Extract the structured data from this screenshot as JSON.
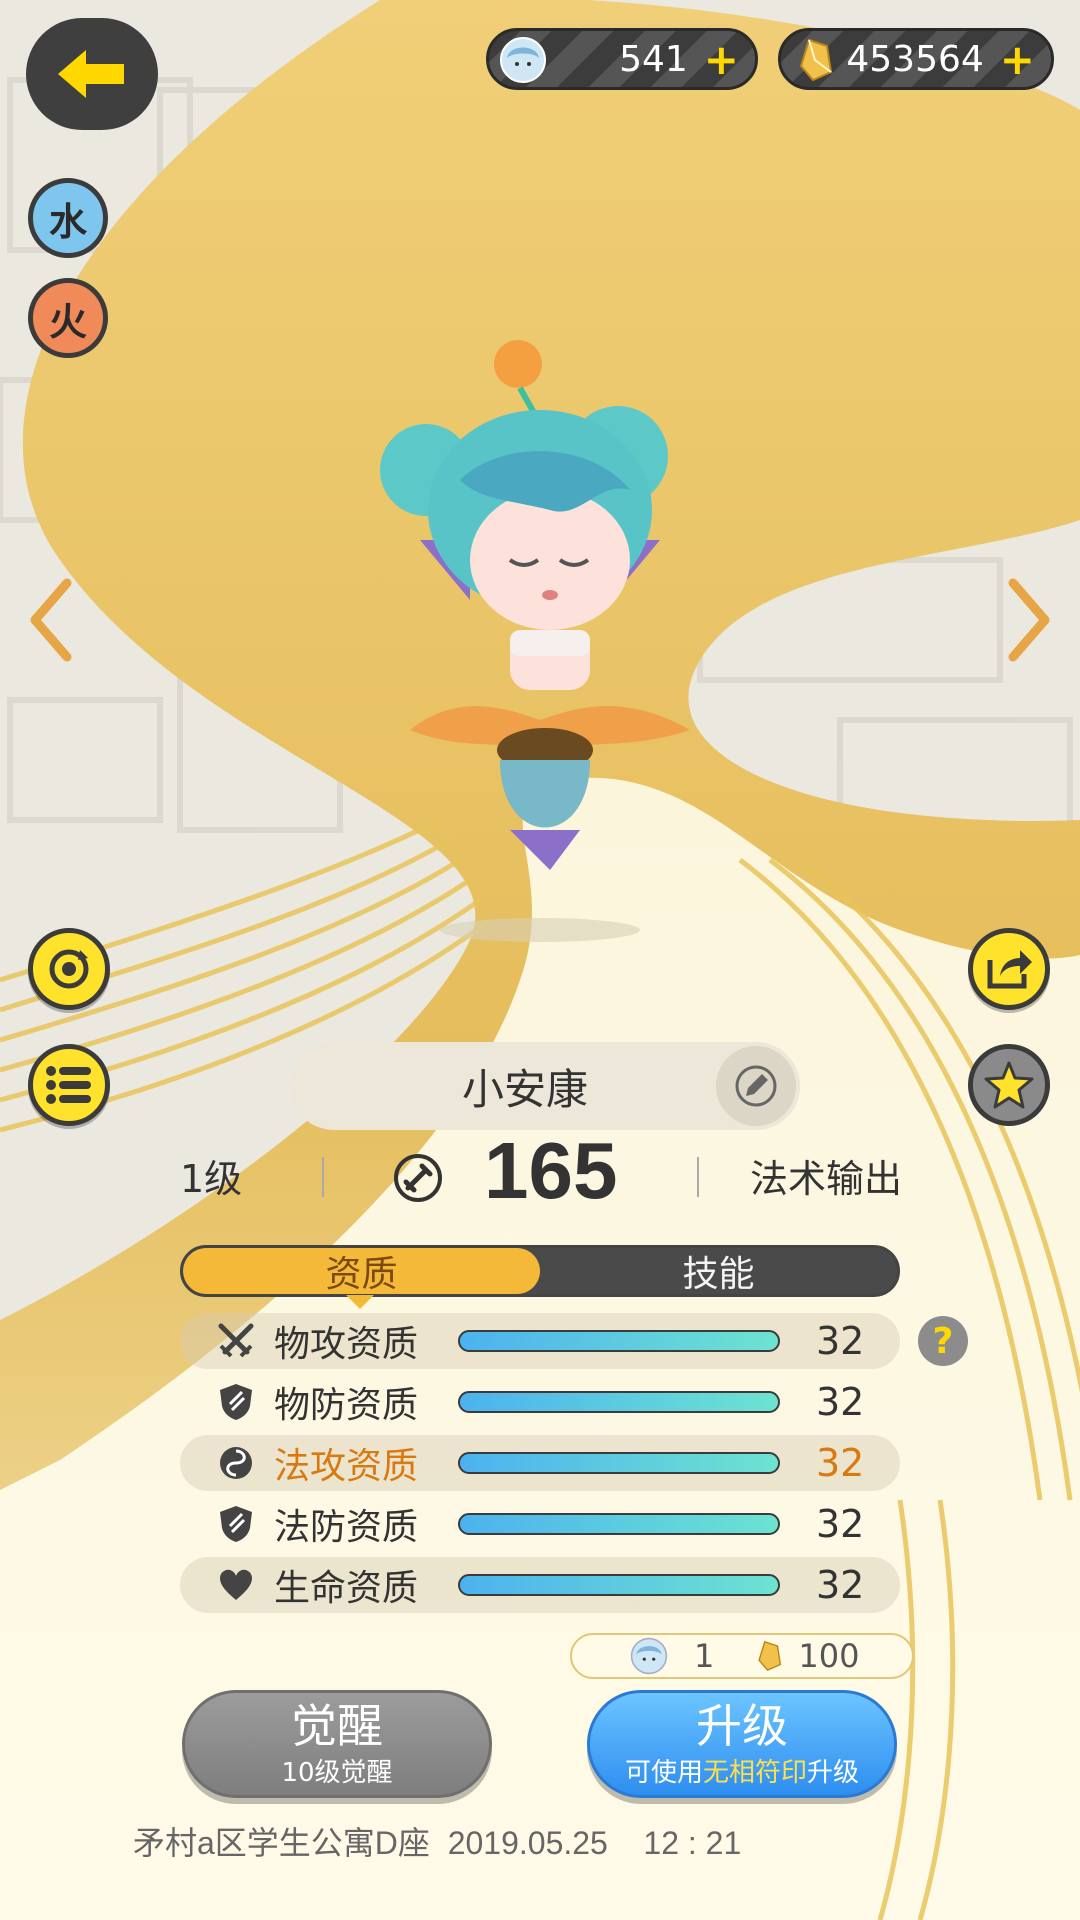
{
  "currencies": [
    {
      "name": "spirit-coin",
      "value": "541",
      "plus": "+"
    },
    {
      "name": "crystal",
      "value": "453564",
      "plus": "+"
    }
  ],
  "elements": [
    "水",
    "火"
  ],
  "pet": {
    "name": "小安康",
    "level": "1级",
    "power": "165",
    "role": "法术输出"
  },
  "tabs": [
    {
      "label": "资质",
      "active": true
    },
    {
      "label": "技能",
      "active": false
    }
  ],
  "stats": [
    {
      "label": "物攻资质",
      "value": "32",
      "icon": "sword-icon",
      "fill": 1.0
    },
    {
      "label": "物防资质",
      "value": "32",
      "icon": "shield-icon",
      "fill": 1.0
    },
    {
      "label": "法攻资质",
      "value": "32",
      "icon": "swirl-icon",
      "fill": 1.0,
      "highlight": true
    },
    {
      "label": "法防资质",
      "value": "32",
      "icon": "shield-icon",
      "fill": 1.0
    },
    {
      "label": "生命资质",
      "value": "32",
      "icon": "heart-icon",
      "fill": 1.0
    }
  ],
  "help": "?",
  "cost": {
    "coin": "1",
    "crystal": "100"
  },
  "buttons": {
    "awaken": {
      "title": "觉醒",
      "sub": "10级觉醒"
    },
    "upgrade": {
      "title": "升级",
      "sub_pre": "可使用",
      "sub_hl": "无相符印",
      "sub_post": "升级"
    }
  },
  "footer": "矛村a区学生公寓D座  2019.05.25    12 : 21",
  "colors": {
    "accent": "#f5b93a",
    "button_blue": "#2e8ef0",
    "highlight": "#d87a10",
    "yellow_btn": "#ffe22b"
  }
}
